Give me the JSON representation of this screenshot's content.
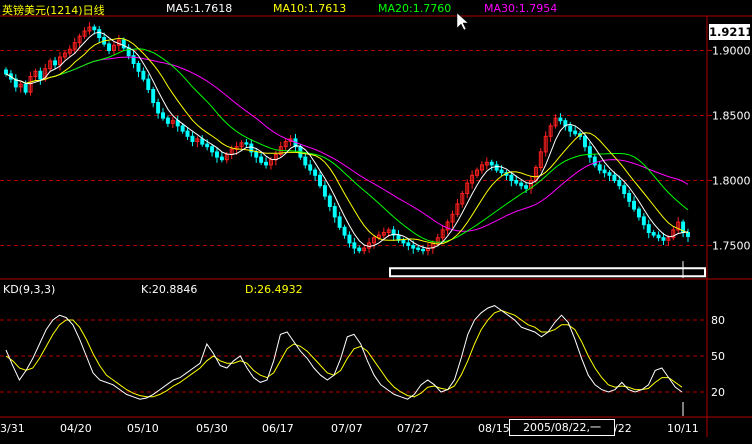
{
  "header": {
    "title": "英镑美元(1214)日线",
    "ma5": "MA5:1.7618",
    "ma10": "MA10:1.7613",
    "ma20": "MA20:1.7760",
    "ma30": "MA30:1.7954"
  },
  "kd_header": {
    "label": "KD(9,3,3)",
    "k": "K:20.8846",
    "d": "D:26.4932"
  },
  "price_box": "1.9211",
  "date_box": "2005/08/22,一",
  "colors": {
    "up": "#ff2020",
    "down": "#00ffff",
    "ma5": "#ffffff",
    "ma10": "#ffff00",
    "ma20": "#00ff00",
    "ma30": "#ff00ff",
    "k": "#ffffff",
    "d": "#ffff00",
    "grid": "#b00000"
  },
  "chart_data": [
    {
      "type": "candlestick",
      "title": "英镑美元(1214)日线",
      "ylim": [
        1.725,
        1.925
      ],
      "y_ticks": [
        "1.9000",
        "1.8500",
        "1.8000",
        "1.7500"
      ],
      "x_ticks": [
        "3/31",
        "04/20",
        "05/10",
        "05/30",
        "06/17",
        "07/07",
        "07/27",
        "08/15",
        "/22",
        "10/11"
      ],
      "series": [
        {
          "name": "MA5",
          "last": 1.7618
        },
        {
          "name": "MA10",
          "last": 1.7613
        },
        {
          "name": "MA20",
          "last": 1.776
        },
        {
          "name": "MA30",
          "last": 1.7954
        }
      ],
      "closes": [
        1.882,
        1.878,
        1.872,
        1.874,
        1.868,
        1.88,
        1.884,
        1.878,
        1.886,
        1.892,
        1.889,
        1.895,
        1.898,
        1.901,
        1.906,
        1.911,
        1.915,
        1.918,
        1.916,
        1.91,
        1.905,
        1.9,
        1.904,
        1.908,
        1.902,
        1.896,
        1.89,
        1.884,
        1.878,
        1.87,
        1.86,
        1.852,
        1.848,
        1.844,
        1.846,
        1.842,
        1.838,
        1.834,
        1.83,
        1.832,
        1.828,
        1.826,
        1.822,
        1.818,
        1.816,
        1.82,
        1.824,
        1.826,
        1.829,
        1.828,
        1.822,
        1.818,
        1.814,
        1.812,
        1.816,
        1.82,
        1.826,
        1.83,
        1.832,
        1.826,
        1.818,
        1.812,
        1.808,
        1.804,
        1.796,
        1.788,
        1.78,
        1.772,
        1.764,
        1.758,
        1.752,
        1.748,
        1.746,
        1.748,
        1.752,
        1.756,
        1.758,
        1.76,
        1.762,
        1.758,
        1.754,
        1.752,
        1.75,
        1.748,
        1.747,
        1.746,
        1.748,
        1.752,
        1.756,
        1.762,
        1.768,
        1.774,
        1.782,
        1.79,
        1.798,
        1.804,
        1.808,
        1.812,
        1.814,
        1.812,
        1.808,
        1.806,
        1.804,
        1.8,
        1.798,
        1.796,
        1.794,
        1.8,
        1.81,
        1.822,
        1.834,
        1.842,
        1.848,
        1.846,
        1.842,
        1.838,
        1.836,
        1.834,
        1.826,
        1.818,
        1.812,
        1.808,
        1.806,
        1.804,
        1.8,
        1.796,
        1.79,
        1.784,
        1.778,
        1.772,
        1.766,
        1.76,
        1.758,
        1.756,
        1.754,
        1.756,
        1.762,
        1.768,
        1.76,
        1.757
      ]
    },
    {
      "type": "line",
      "title": "KD(9,3,3)",
      "ylim": [
        0,
        100
      ],
      "y_ticks": [
        20,
        50,
        80
      ],
      "series": [
        {
          "name": "K",
          "last": 20.8846,
          "values": [
            55,
            42,
            30,
            38,
            48,
            60,
            72,
            80,
            84,
            82,
            76,
            64,
            50,
            36,
            30,
            28,
            26,
            22,
            18,
            16,
            14,
            15,
            18,
            22,
            26,
            30,
            32,
            36,
            40,
            44,
            60,
            52,
            42,
            40,
            46,
            50,
            40,
            32,
            28,
            30,
            46,
            68,
            70,
            62,
            54,
            48,
            40,
            34,
            30,
            34,
            48,
            66,
            68,
            60,
            46,
            34,
            26,
            22,
            18,
            16,
            14,
            18,
            26,
            30,
            26,
            20,
            22,
            30,
            48,
            68,
            80,
            86,
            90,
            92,
            88,
            84,
            80,
            74,
            72,
            70,
            66,
            70,
            78,
            84,
            78,
            64,
            48,
            34,
            26,
            22,
            20,
            22,
            28,
            22,
            20,
            22,
            26,
            38,
            40,
            32,
            24,
            20
          ]
        },
        {
          "name": "D",
          "last": 26.4932,
          "values": [
            50,
            46,
            40,
            38,
            40,
            48,
            58,
            68,
            76,
            80,
            80,
            74,
            64,
            52,
            42,
            34,
            30,
            26,
            22,
            19,
            17,
            16,
            16,
            18,
            21,
            25,
            28,
            32,
            36,
            40,
            46,
            50,
            46,
            44,
            44,
            46,
            44,
            38,
            34,
            32,
            36,
            46,
            56,
            60,
            58,
            54,
            48,
            42,
            36,
            34,
            38,
            48,
            56,
            58,
            54,
            46,
            38,
            30,
            24,
            20,
            17,
            16,
            19,
            24,
            25,
            23,
            22,
            25,
            34,
            46,
            60,
            72,
            80,
            86,
            88,
            86,
            84,
            80,
            76,
            74,
            70,
            70,
            72,
            76,
            76,
            72,
            62,
            50,
            40,
            32,
            26,
            24,
            25,
            24,
            22,
            22,
            23,
            28,
            32,
            32,
            28,
            24
          ]
        }
      ]
    }
  ]
}
